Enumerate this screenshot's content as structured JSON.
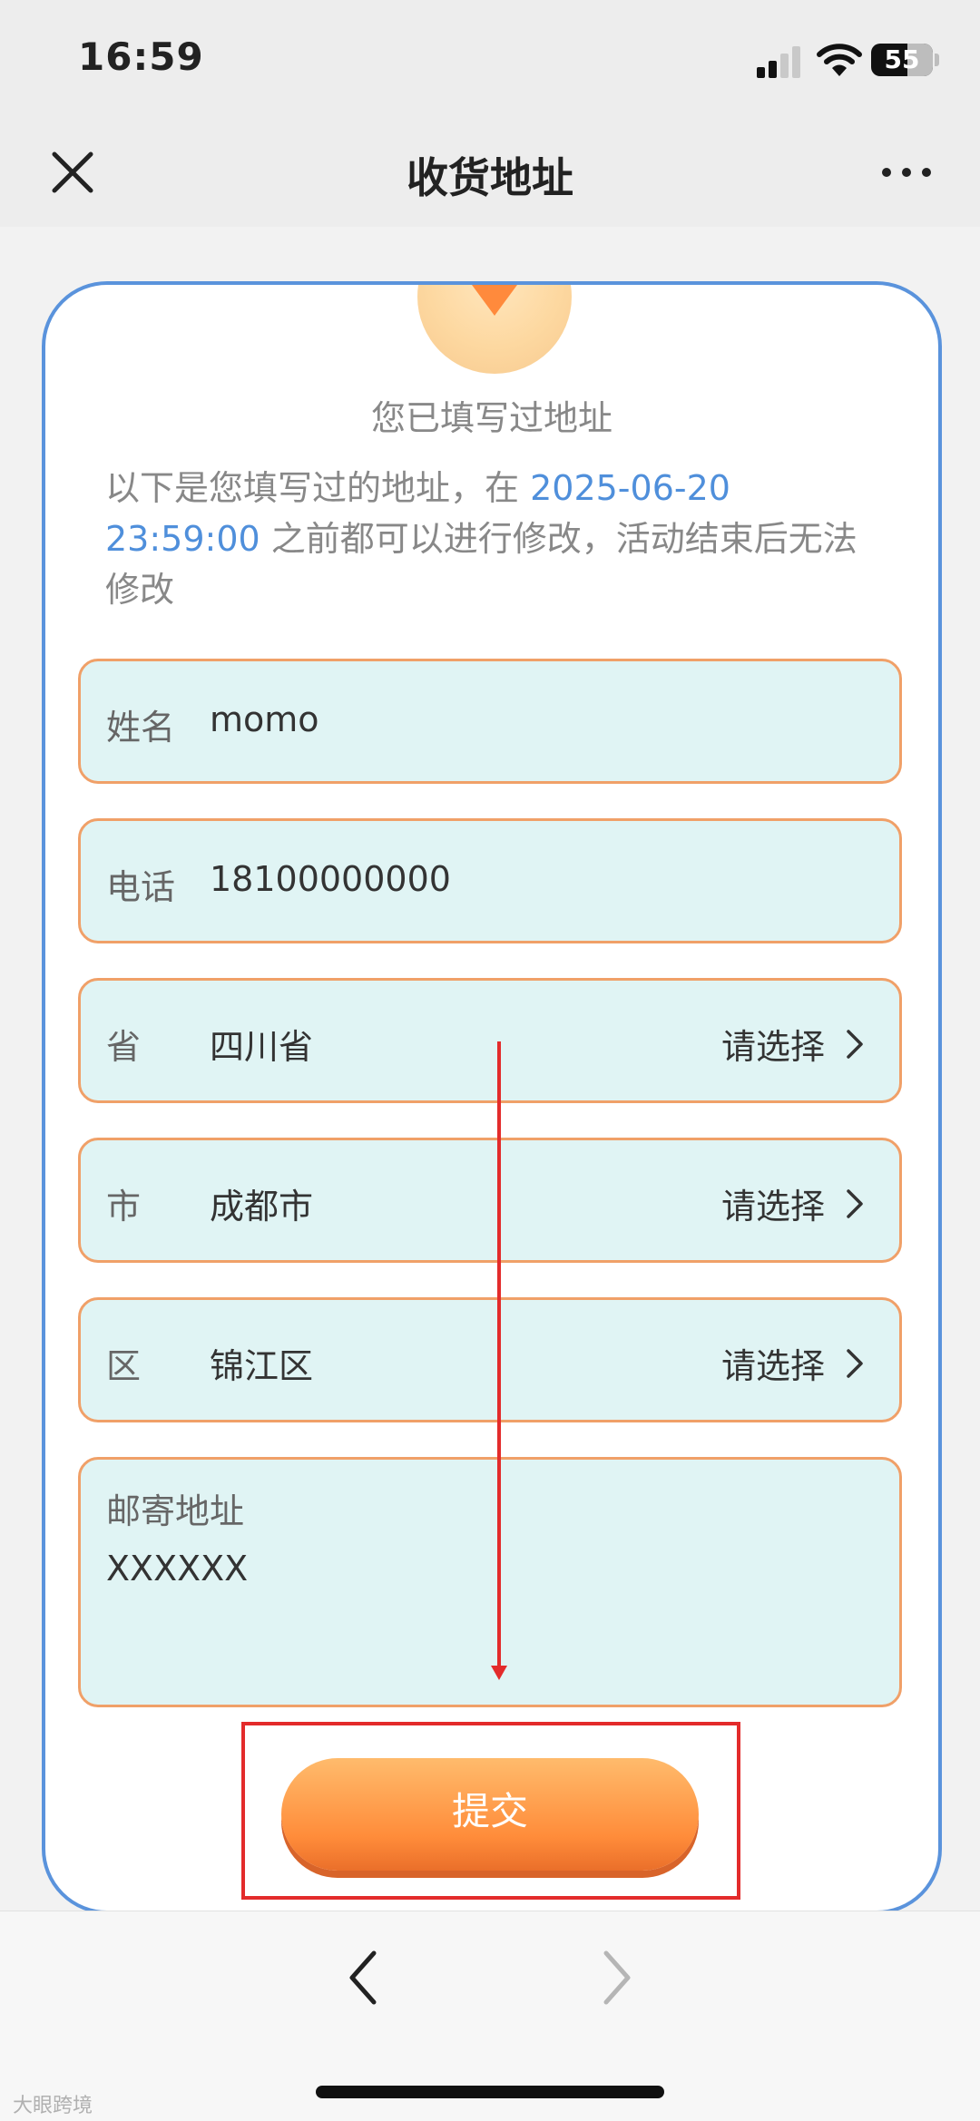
{
  "status_bar": {
    "time": "16:59",
    "battery": "55"
  },
  "nav": {
    "title": "收货地址"
  },
  "card": {
    "headline": "您已填写过地址",
    "notice_before": "以下是您填写过的地址，在 ",
    "deadline": "2025-06-20 23:59:00",
    "notice_after": " 之前都可以进行修改，活动结束后无法修改"
  },
  "form": {
    "name": {
      "label": "姓名",
      "value": "momo"
    },
    "phone": {
      "label": "电话",
      "value": "18100000000"
    },
    "province": {
      "label": "省",
      "value": "四川省",
      "choose": "请选择"
    },
    "city": {
      "label": "市",
      "value": "成都市",
      "choose": "请选择"
    },
    "district": {
      "label": "区",
      "value": "锦江区",
      "choose": "请选择"
    },
    "address": {
      "label": "邮寄地址",
      "value": "XXXXXX"
    },
    "submit": "提交"
  },
  "watermark": "大眼跨境"
}
